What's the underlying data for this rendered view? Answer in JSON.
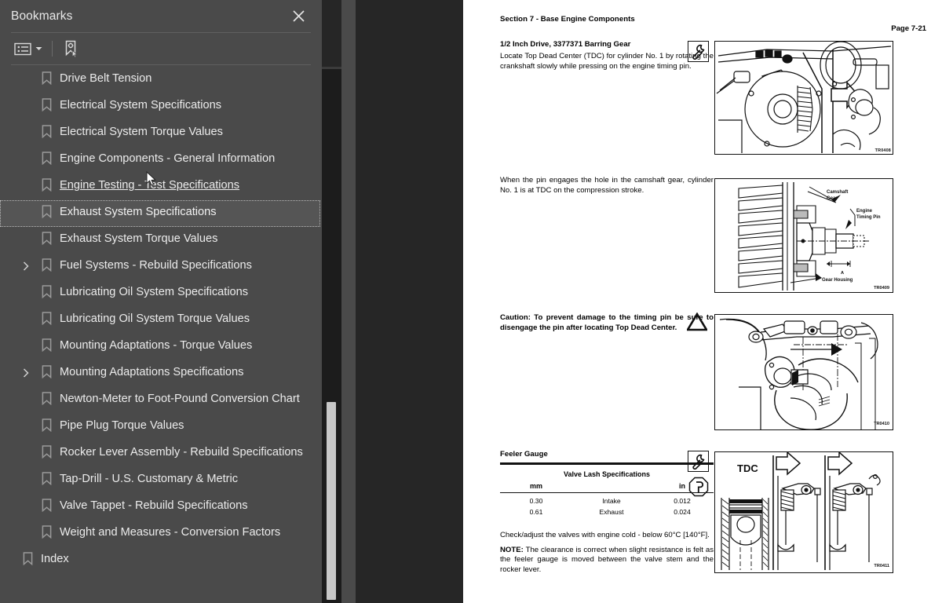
{
  "sidebar": {
    "title": "Bookmarks",
    "close_icon": "close-icon",
    "toolbar": {
      "list_options_icon": "list-options-icon",
      "caret_icon": "chevron-down-icon",
      "new_bookmark_icon": "new-bookmark-icon"
    },
    "items": [
      {
        "label": "Drive Belt Tension",
        "level": 1,
        "expandable": false,
        "state": "normal"
      },
      {
        "label": "Electrical System Specifications",
        "level": 1,
        "expandable": false,
        "state": "normal"
      },
      {
        "label": "Electrical System Torque Values",
        "level": 1,
        "expandable": false,
        "state": "normal"
      },
      {
        "label": "Engine Components - General Information",
        "level": 1,
        "expandable": false,
        "state": "normal"
      },
      {
        "label": "Engine Testing - Test Specifications",
        "level": 1,
        "expandable": false,
        "state": "hover"
      },
      {
        "label": "Exhaust System Specifications",
        "level": 1,
        "expandable": false,
        "state": "selected"
      },
      {
        "label": "Exhaust System Torque Values",
        "level": 1,
        "expandable": false,
        "state": "normal"
      },
      {
        "label": "Fuel Systems - Rebuild Specifications",
        "level": 1,
        "expandable": true,
        "state": "normal"
      },
      {
        "label": "Lubricating Oil System Specifications",
        "level": 1,
        "expandable": false,
        "state": "normal"
      },
      {
        "label": "Lubricating Oil System Torque Values",
        "level": 1,
        "expandable": false,
        "state": "normal"
      },
      {
        "label": "Mounting Adaptations - Torque Values",
        "level": 1,
        "expandable": false,
        "state": "normal"
      },
      {
        "label": "Mounting Adaptations Specifications",
        "level": 1,
        "expandable": true,
        "state": "normal"
      },
      {
        "label": "Newton-Meter to Foot-Pound Conversion Chart",
        "level": 1,
        "expandable": false,
        "state": "normal"
      },
      {
        "label": "Pipe Plug Torque Values",
        "level": 1,
        "expandable": false,
        "state": "normal"
      },
      {
        "label": "Rocker Lever Assembly - Rebuild Specifications",
        "level": 1,
        "expandable": false,
        "state": "normal"
      },
      {
        "label": "Tap-Drill - U.S. Customary & Metric",
        "level": 1,
        "expandable": false,
        "state": "normal"
      },
      {
        "label": "Valve Tappet - Rebuild Specifications",
        "level": 1,
        "expandable": false,
        "state": "normal"
      },
      {
        "label": "Weight and Measures - Conversion Factors",
        "level": 1,
        "expandable": false,
        "state": "normal"
      },
      {
        "label": "Index",
        "level": 0,
        "expandable": false,
        "state": "normal"
      }
    ]
  },
  "divider": {
    "collapse_icon": "chevron-left-icon"
  },
  "document": {
    "section_header": "Section 7 - Base Engine Components",
    "page_number": "Page 7-21",
    "blocks": [
      {
        "heading": "1/2 Inch Drive, 3377371 Barring Gear",
        "body": "Locate Top Dead Center (TDC) for cylinder No. 1 by rotating the crankshaft slowly while pressing on the engine timing pin.",
        "tool_icon": "wrench-icon",
        "figure_id": "TR0408"
      },
      {
        "heading": "",
        "body": "When the pin engages the hole in the camshaft gear, cylinder No. 1 is at TDC on the compression stroke.",
        "tool_icon": "",
        "figure_id": "TR0409",
        "figure_labels": [
          "Camshaft Gear",
          "Engine Timing Pin",
          "Gear Housing"
        ]
      },
      {
        "heading": "",
        "body": "Caution: To prevent damage to the timing pin be sure to disengage the pin after locating Top Dead Center.",
        "tool_icon": "warning-triangle-icon",
        "figure_id": "TR0410"
      }
    ],
    "feeler_section": {
      "heading": "Feeler Gauge",
      "tool_icons": [
        "wrench-icon",
        "feeler-gauge-icon"
      ],
      "figure_id": "TR0411",
      "figure_label": "TDC",
      "note_line_1": "Check/adjust the valves with engine cold - below 60°C [140°F].",
      "note_prefix": "NOTE:",
      "note_line_2": " The clearance is correct when slight resistance is felt as the feeler gauge is moved between the valve stem and the rocker lever."
    },
    "valve_lash_table": {
      "title": "Valve Lash Specifications",
      "columns": [
        "mm",
        "",
        "in"
      ],
      "rows": [
        [
          "0.30",
          "Intake",
          "0.012"
        ],
        [
          "0.61",
          "Exhaust",
          "0.024"
        ]
      ]
    }
  },
  "colors": {
    "sidebar_bg": "#4a4a4a",
    "viewer_bg": "#262626",
    "page_bg": "#ffffff",
    "scrollbar_track": "#1c1c1c",
    "scrollbar_thumb": "#c8c8c8",
    "text": "#ececec"
  }
}
